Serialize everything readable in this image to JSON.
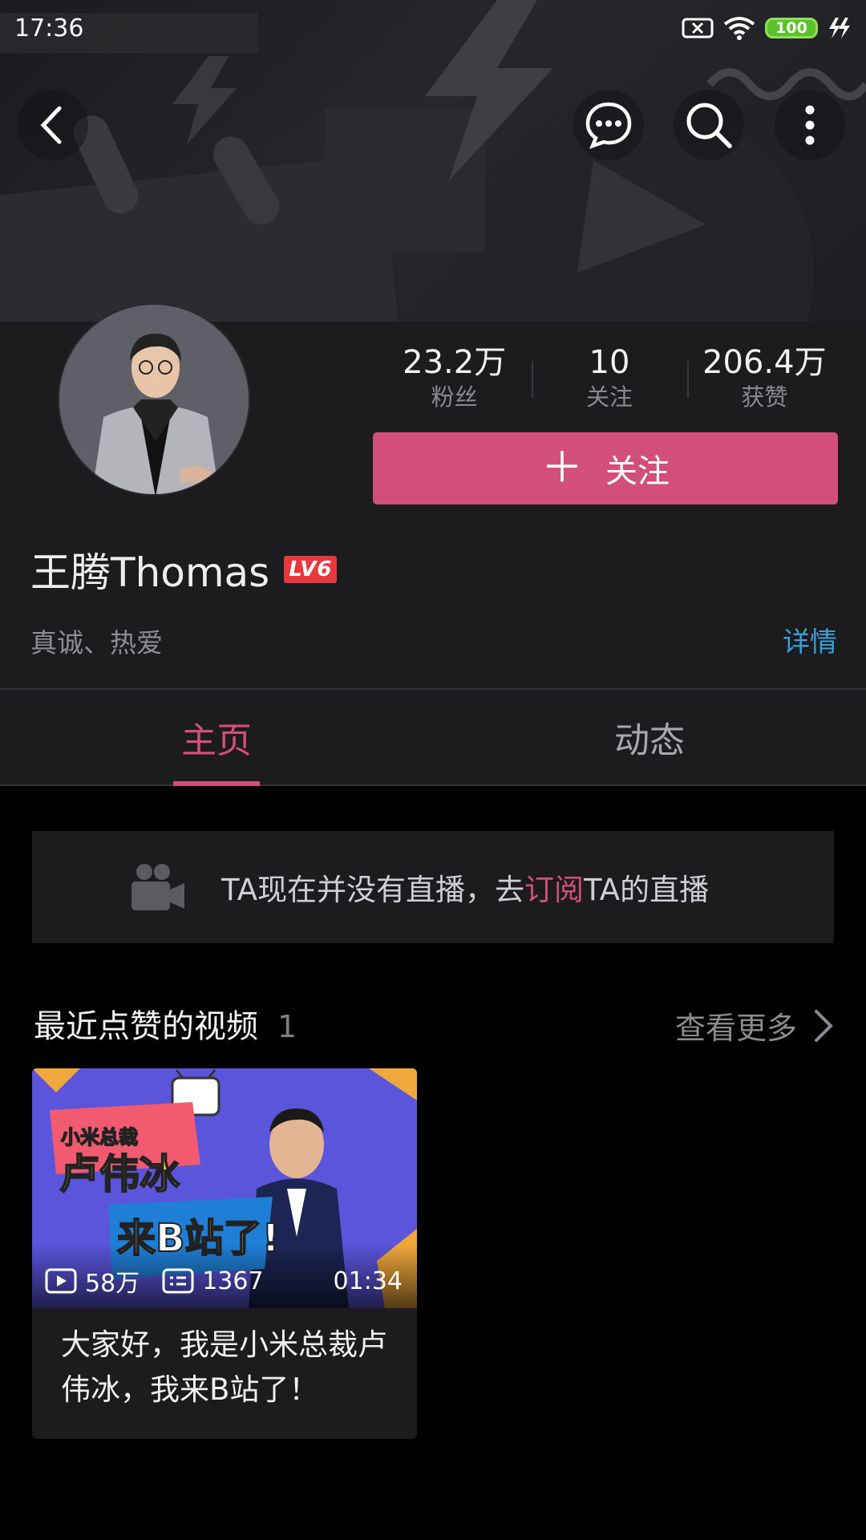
{
  "status_bar": {
    "time": "17:36",
    "battery": "100"
  },
  "profile": {
    "name": "王腾Thomas",
    "level": "LV6",
    "bio": "真诚、热爱",
    "detail_link": "详情",
    "stats": [
      {
        "value": "23.2万",
        "label": "粉丝"
      },
      {
        "value": "10",
        "label": "关注"
      },
      {
        "value": "206.4万",
        "label": "获赞"
      }
    ],
    "follow_button": {
      "icon": "plus-icon",
      "label": "关注"
    }
  },
  "tabs": [
    {
      "label": "主页",
      "active": true
    },
    {
      "label": "动态",
      "active": false
    }
  ],
  "live_banner": {
    "text_before": "TA现在并没有直播，去",
    "highlight": "订阅",
    "text_after": "TA的直播"
  },
  "liked_videos": {
    "title": "最近点赞的视频",
    "count": "1",
    "more_label": "查看更多",
    "items": [
      {
        "views": "58万",
        "danmaku": "1367",
        "duration": "01:34",
        "title": "大家好，我是小米总裁卢伟冰，我来B站了！",
        "thumb_text": {
          "top": "小米总裁",
          "middle": "卢伟冰",
          "bottom": "来B站了!"
        }
      }
    ]
  },
  "colors": {
    "accent": "#d24f7c",
    "link": "#3a9fd6",
    "background": "#000000",
    "panel": "#1c1c1f"
  }
}
